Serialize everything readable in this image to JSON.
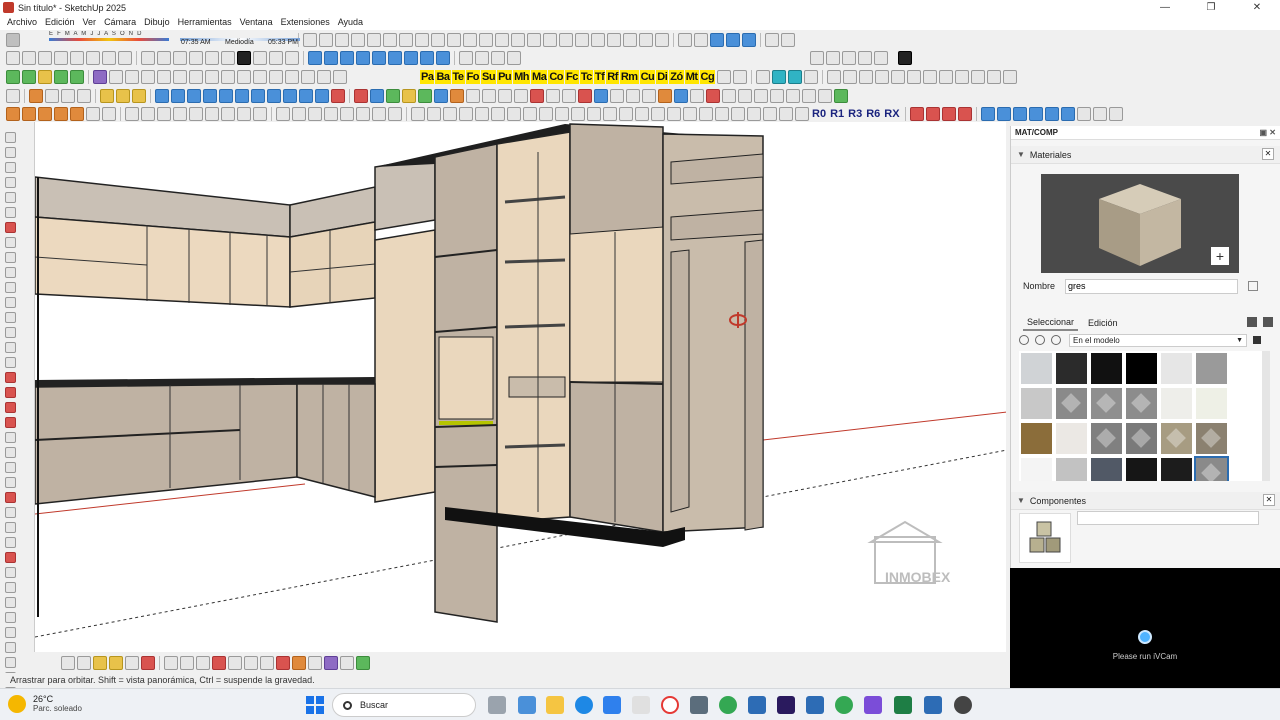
{
  "window": {
    "title": "Sin título* - SketchUp 2025",
    "controls": [
      "—",
      "❐",
      "✕"
    ]
  },
  "menu": [
    "Archivo",
    "Edición",
    "Ver",
    "Cámara",
    "Dibujo",
    "Herramientas",
    "Ventana",
    "Extensiones",
    "Ayuda"
  ],
  "shadow": {
    "months": "E F M A M J J A S O N D",
    "time_start": "07:35 AM",
    "time_mid": "Mediodía",
    "time_end": "05:33 PM"
  },
  "plugin_buttons": [
    "Pa",
    "Ba",
    "Te",
    "Fo",
    "Su",
    "Pu",
    "Mh",
    "Ma",
    "Co",
    "Fc",
    "Tc",
    "Tf",
    "Rf",
    "Rm",
    "Cu",
    "Di",
    "Zó",
    "Mt",
    "Cg"
  ],
  "rotate_buttons": [
    "R0",
    "R1",
    "R3",
    "R6",
    "RX"
  ],
  "panel": {
    "title": "MAT/COMP",
    "materials_header": "Materiales",
    "name_label": "Nombre",
    "name_value": "gres",
    "tab_select": "Seleccionar",
    "tab_edit": "Edición",
    "model_dropdown": "En el modelo",
    "components_header": "Componentes",
    "swatch_colors": [
      "#d0d3d6",
      "#2b2b2b",
      "#111111",
      "#000000",
      "#e6e6e6",
      "#9a9a9a",
      "#c8c8c8",
      "#8a8a8a",
      "#8f8f8f",
      "#8c8c8c",
      "#eeeeea",
      "#eef0e6",
      "#8b6d3a",
      "#ebe8e4",
      "#808080",
      "#7a7a7a",
      "#a79c82",
      "#8b8170",
      "#f4f4f4",
      "#c2c2c2",
      "#515966",
      "#161616",
      "#1c1c1c",
      "#8a8a8a"
    ],
    "selected_swatch_index": 23,
    "preview_color": "#b7ab96"
  },
  "webcam": {
    "message": "Please run iVCam"
  },
  "status_text": "Arrastrar para orbitar. Shift = vista panorámica, Ctrl = suspende la gravedad.",
  "watermark": "INMOBEX",
  "taskbar": {
    "temperature": "26°C",
    "condition": "Parc. soleado",
    "search_placeholder": "Buscar"
  }
}
